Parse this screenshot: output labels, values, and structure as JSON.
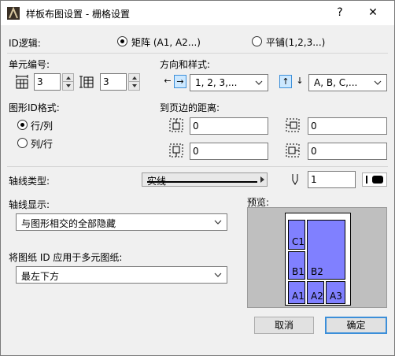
{
  "window": {
    "title": "样板布图设置 - 栅格设置",
    "help_glyph": "?",
    "close_glyph": "✕"
  },
  "id_logic": {
    "label": "ID逻辑:",
    "options": [
      {
        "label": "矩阵 (A1, A2...)",
        "selected": true
      },
      {
        "label": "平铺(1,2,3...)",
        "selected": false
      }
    ]
  },
  "cell_numbering": {
    "label": "单元编号:",
    "columns_value": "3",
    "rows_value": "3"
  },
  "direction_style": {
    "label": "方向和样式:",
    "horizontal": {
      "left_arrow": "←",
      "right_arrow": "→",
      "active": "right",
      "style_value": "1, 2, 3,..."
    },
    "vertical": {
      "up_arrow": "↑",
      "down_arrow": "↓",
      "active": "up",
      "style_value": "A, B, C,..."
    }
  },
  "graphic_id_format": {
    "label": "图形ID格式:",
    "options": [
      {
        "label": "行/列",
        "selected": true
      },
      {
        "label": "列/行",
        "selected": false
      }
    ]
  },
  "margins": {
    "label": "到页边的距离:",
    "top": "0",
    "bottom": "0",
    "left": "0",
    "right": "0"
  },
  "axis_type": {
    "label": "轴线类型:",
    "line_type": "实线",
    "pen_value": "1"
  },
  "axis_display": {
    "label": "轴线显示:",
    "value": "与图形相交的全部隐藏"
  },
  "apply_id": {
    "label": "将图纸 ID 应用于多元图纸:",
    "value": "最左下方"
  },
  "preview": {
    "label": "预览:",
    "cells": [
      "C1",
      "B1",
      "B2",
      "A1",
      "A2",
      "A3"
    ],
    "fill_color": "#8080ff"
  },
  "buttons": {
    "cancel": "取消",
    "ok": "确定"
  },
  "colors": {
    "accent": "#3c8fd9",
    "toggle_bg": "#cce8ff"
  }
}
